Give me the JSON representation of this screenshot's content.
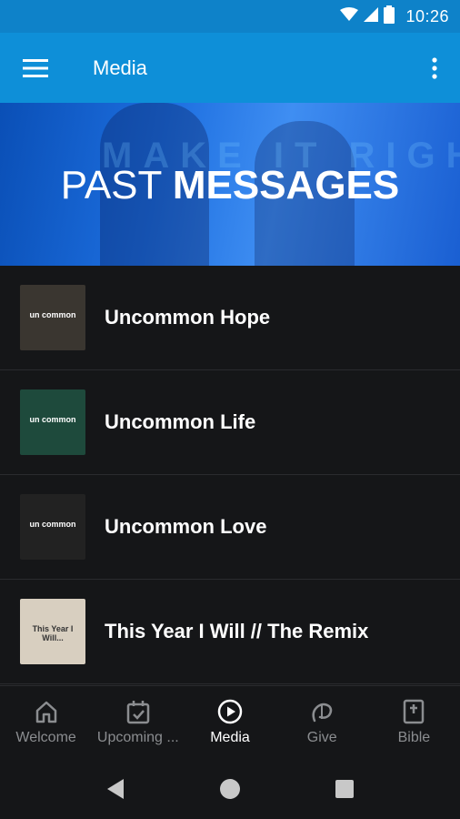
{
  "status_bar": {
    "time": "10:26"
  },
  "app_bar": {
    "title": "Media"
  },
  "banner": {
    "title_light": "PAST ",
    "title_bold": "MESSAGES",
    "background_text": "MAKE IT RIGHT"
  },
  "messages": [
    {
      "title": "Uncommon Hope",
      "thumb_text": "un common",
      "thumb_bg": "#3a3630"
    },
    {
      "title": "Uncommon Life",
      "thumb_text": "un common",
      "thumb_bg": "#1e4a3c"
    },
    {
      "title": "Uncommon Love",
      "thumb_text": "un common",
      "thumb_bg": "#222222"
    },
    {
      "title": "This Year I Will // The Remix",
      "thumb_text": "This Year I Will...",
      "thumb_bg": "#d8cfc0"
    }
  ],
  "bottom_nav": [
    {
      "label": "Welcome",
      "icon": "home-icon"
    },
    {
      "label": "Upcoming ...",
      "icon": "calendar-check-icon"
    },
    {
      "label": "Media",
      "icon": "play-circle-icon",
      "active": true
    },
    {
      "label": "Give",
      "icon": "give-icon"
    },
    {
      "label": "Bible",
      "icon": "bible-icon"
    }
  ],
  "colors": {
    "app_bar": "#0e8fd8",
    "status_bar": "#0e82c9",
    "background": "#151618"
  }
}
